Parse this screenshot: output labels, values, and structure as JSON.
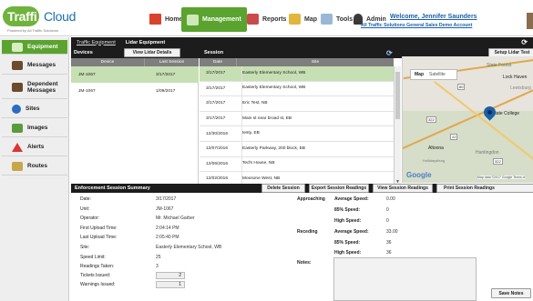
{
  "header": {
    "logo_main": "Traffi",
    "logo_cloud": "Cloud",
    "logo_tag": "Powered by All Traffic Solutions",
    "nav": [
      {
        "label": "Home",
        "icon": "home-icon"
      },
      {
        "label": "Management",
        "icon": "gear-icon"
      },
      {
        "label": "Reports",
        "icon": "chart-icon"
      },
      {
        "label": "Map",
        "icon": "map-icon"
      },
      {
        "label": "Tools",
        "icon": "tools-icon"
      },
      {
        "label": "Admin",
        "icon": "admin-icon"
      }
    ],
    "welcome": "Welcome, Jennifer Saunders",
    "org": "All Traffic Solutions General Sales Demo Account"
  },
  "sidebar": [
    {
      "label": "Equipment",
      "icon": "gear-icon"
    },
    {
      "label": "Messages",
      "icon": "message-sign-icon"
    },
    {
      "label": "Dependent Messages",
      "icon": "message-sign-icon"
    },
    {
      "label": "Sites",
      "icon": "map-pin-icon"
    },
    {
      "label": "Images",
      "icon": "image-icon"
    },
    {
      "label": "Alerts",
      "icon": "alert-icon"
    },
    {
      "label": "Routes",
      "icon": "route-icon"
    }
  ],
  "breadcrumb": {
    "link": "Traffic Equipment",
    "current": "Lidar Equipment"
  },
  "devices": {
    "title": "Devices",
    "button": "View Lidar Details",
    "col_device": "Device",
    "col_last": "Last Session",
    "rows": [
      {
        "device": "JM-1067",
        "last": "3/17/2017"
      },
      {
        "device": "JM-1067",
        "last": "1/09/2017"
      }
    ]
  },
  "sessions": {
    "title": "Session",
    "col_date": "Date",
    "col_site": "Site",
    "rows": [
      {
        "date": "3/17/2017",
        "site": "Easterly Elementary School, WB"
      },
      {
        "date": "3/17/2017",
        "site": "Easterly Elementary School, WB"
      },
      {
        "date": "3/17/2017",
        "site": "Eric Test, NB"
      },
      {
        "date": "3/17/2017",
        "site": "Main st near broad st, EB"
      },
      {
        "date": "12/30/2016",
        "site": "testy, EB"
      },
      {
        "date": "12/07/2016",
        "site": "Easterly Parkway, 200 block, EB"
      },
      {
        "date": "12/06/2016",
        "site": "Ted's House, NB"
      },
      {
        "date": "12/02/2016",
        "site": "Moosone West, NB"
      }
    ]
  },
  "map": {
    "setup_button": "Setup Lidar Test",
    "tab_map": "Map",
    "tab_sat": "Satellite",
    "google": "Google",
    "attribution": "Map data ©2017 Google  Terms of",
    "places": [
      "State Forest",
      "Lock Haven",
      "Lewisburg",
      "State College",
      "Altoona",
      "Huntingdon",
      "Hollidaysburg"
    ],
    "roads": [
      "80",
      "22",
      "322",
      "322"
    ]
  },
  "summary": {
    "title": "Enforcement Session Summary",
    "btn_delete": "Delete Session",
    "btn_export": "Export Session Readings",
    "btn_view": "View Session Readings",
    "btn_print": "Print Session Readings",
    "fields": [
      {
        "label": "Date:",
        "value": "3/17/2017"
      },
      {
        "label": "Unit:",
        "value": "JM-1067"
      },
      {
        "label": "Operator:",
        "value": "Mr. Michael Garber"
      },
      {
        "label": "First Upload Time:",
        "value": "2:04:14 PM"
      },
      {
        "label": "Last Upload Time:",
        "value": "2:05:40 PM"
      },
      {
        "label": "Site:",
        "value": "Easterly Elementary School, WB"
      },
      {
        "label": "Speed Limit:",
        "value": "25"
      },
      {
        "label": "Readings Taken:",
        "value": "3"
      }
    ],
    "tickets_label": "Tickets Issued:",
    "tickets_value": "2",
    "warnings_label": "Warnings Issued:",
    "warnings_value": "1",
    "approaching": "Approaching",
    "receding": "Receding",
    "stats_labels": [
      "Average Speed:",
      "85% Speed:",
      "High Speed:",
      "Average Speed:",
      "85% Speed:",
      "High Speed:"
    ],
    "stats_values": [
      "0.00",
      "0",
      "0",
      "33.00",
      "36",
      "36"
    ],
    "notes_label": "Notes:",
    "save_notes": "Save Notes"
  }
}
